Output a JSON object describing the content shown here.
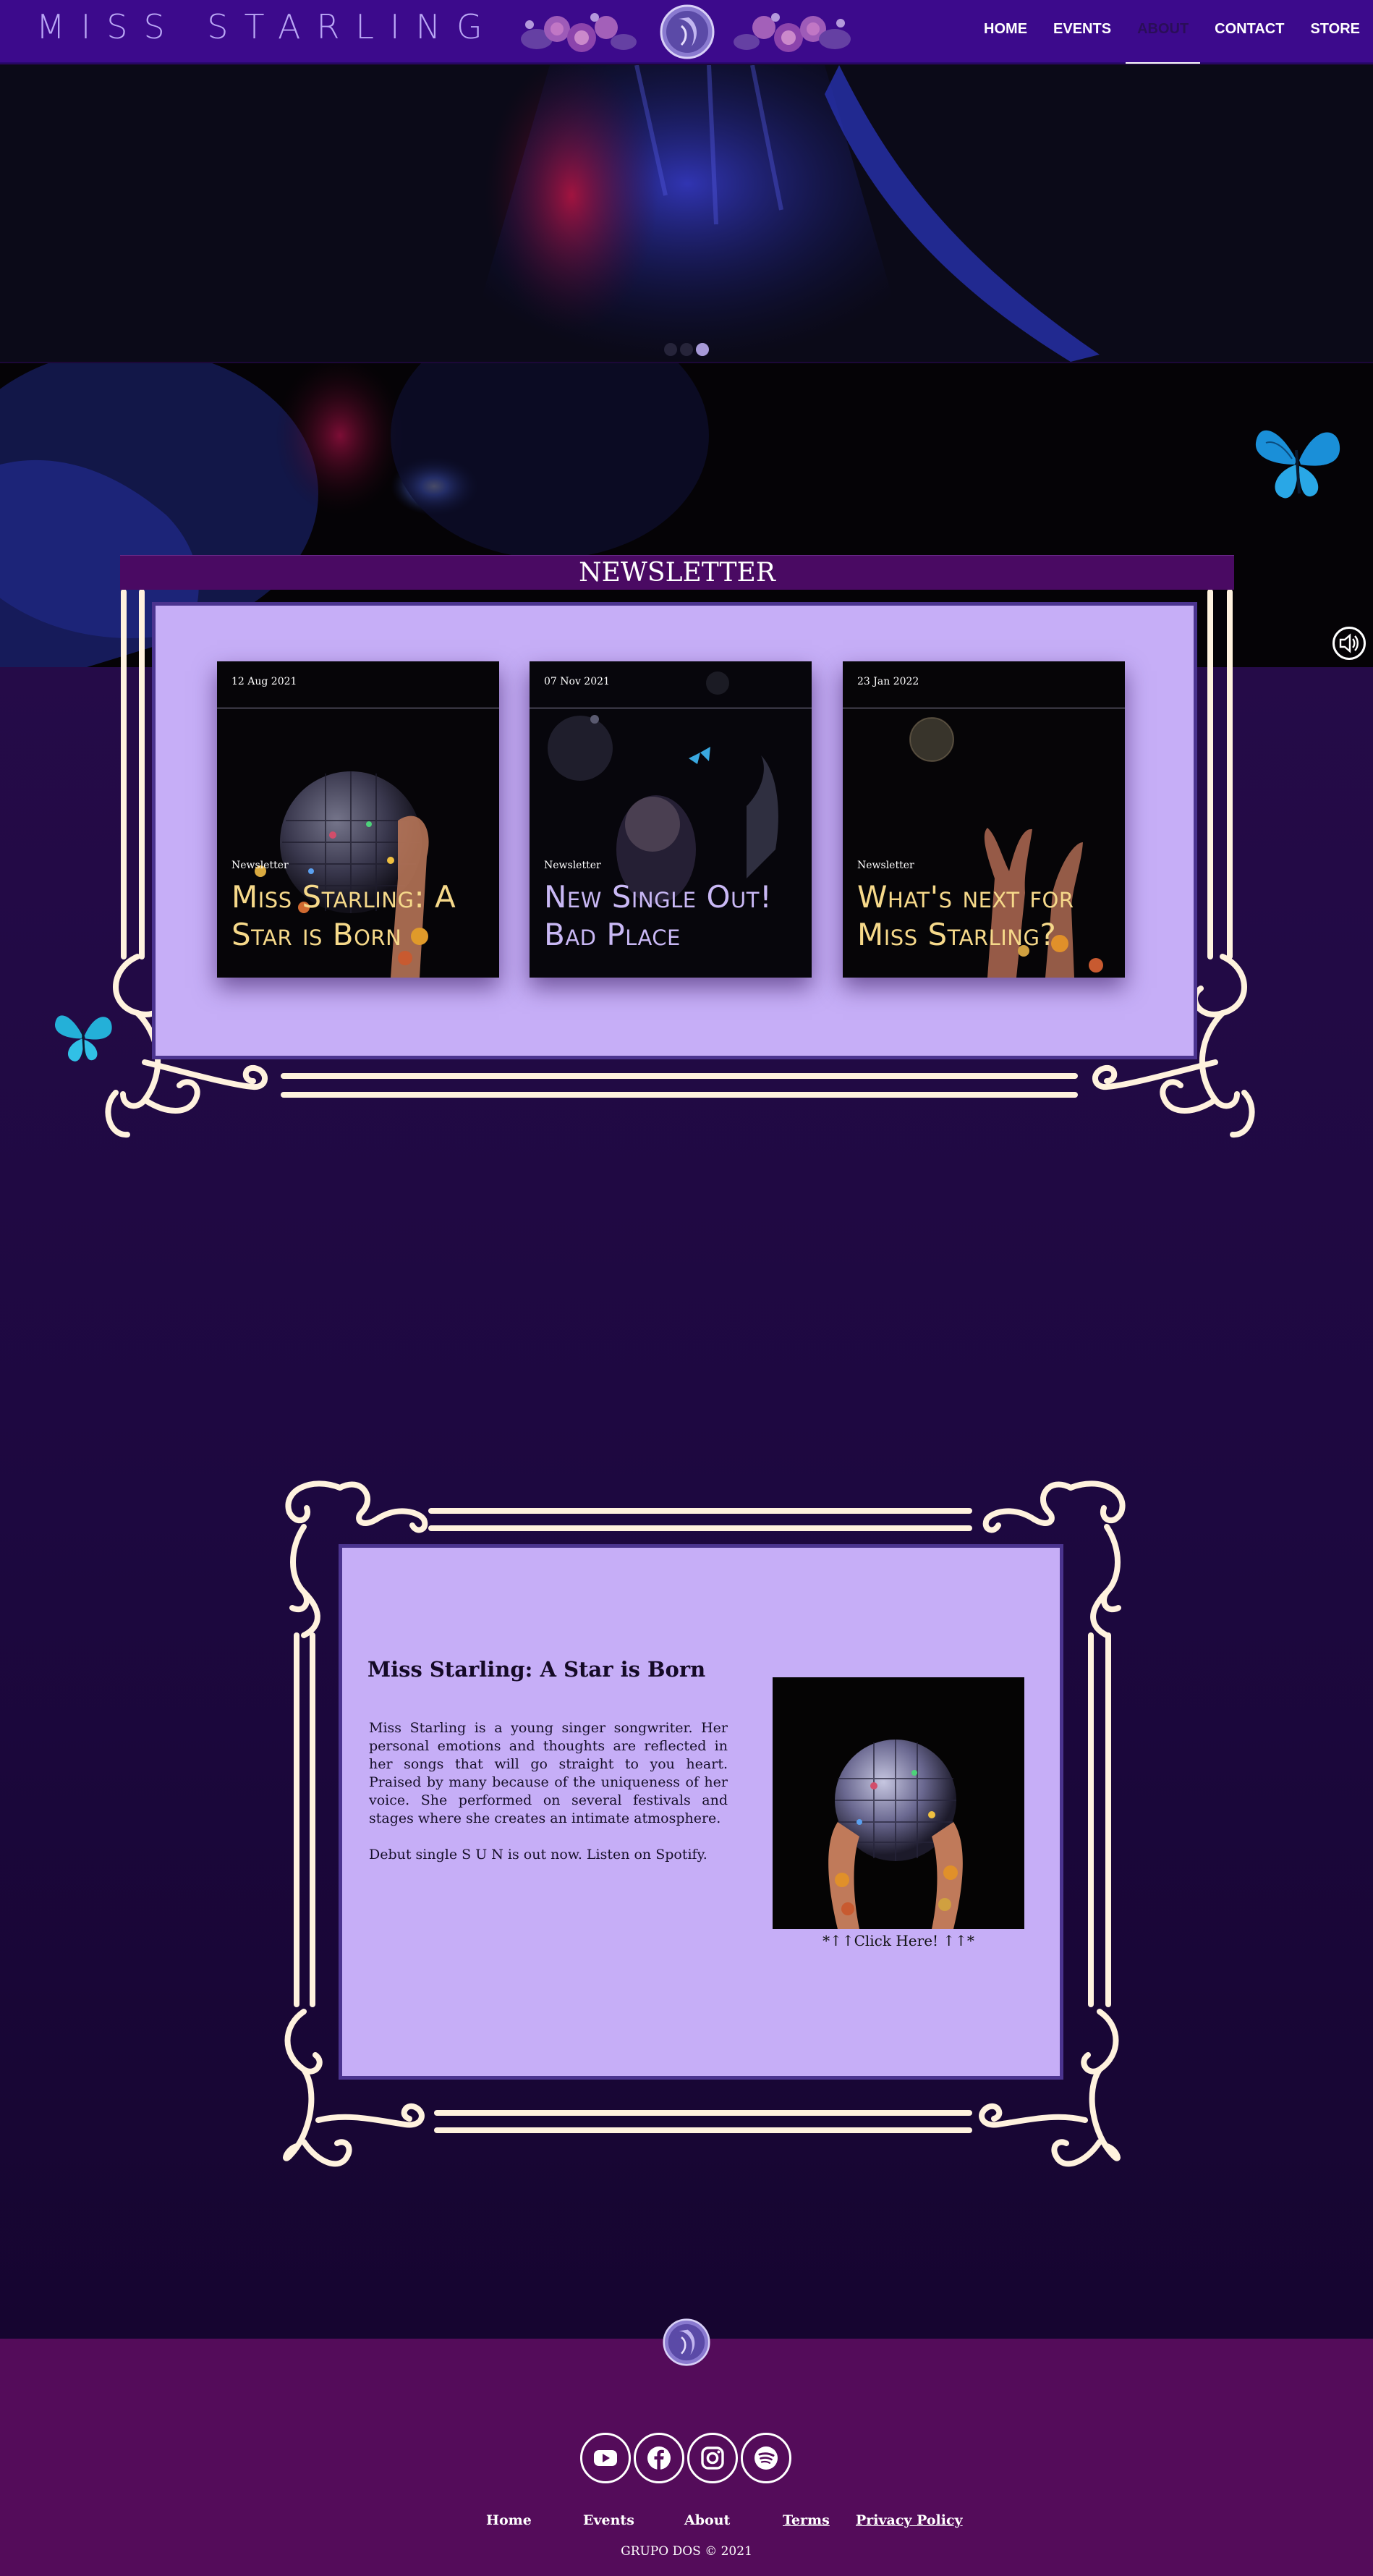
{
  "header": {
    "logo": "MISS STARLING",
    "nav": [
      {
        "label": "HOME"
      },
      {
        "label": "EVENTS"
      },
      {
        "label": "ABOUT",
        "active": true
      },
      {
        "label": "CONTACT"
      },
      {
        "label": "STORE"
      }
    ]
  },
  "hero": {
    "slides_count": 3,
    "active_slide": 3
  },
  "newsletter": {
    "title": "NEWSLETTER",
    "cards": [
      {
        "date": "12 Aug 2021",
        "category": "Newsletter",
        "title": "Miss Starling: A Star is Born",
        "title_color": "#f6d98a"
      },
      {
        "date": "07 Nov 2021",
        "category": "Newsletter",
        "title": "New Single Out! Bad Place",
        "title_color": "#c9b8f5"
      },
      {
        "date": "23 Jan 2022",
        "category": "Newsletter",
        "title": "What's next for Miss Starling?",
        "title_color": "#f6d98a"
      }
    ]
  },
  "about": {
    "title": "Miss Starling: A Star is Born",
    "paragraph1": "Miss Starling is a young singer songwriter. Her personal emotions and thoughts are reflected in her songs that will go straight to you heart. Praised by many because of the uniqueness of her voice. She performed on several festivals and stages where she creates an intimate atmosphere.",
    "paragraph2": "Debut single S U N is out now. Listen on Spotify.",
    "click_label": "*↑↑Click Here! ↑↑*"
  },
  "footer": {
    "social": [
      "youtube-icon",
      "facebook-icon",
      "instagram-icon",
      "spotify-icon"
    ],
    "links": [
      {
        "label": "Home",
        "underline": false
      },
      {
        "label": "Events",
        "underline": false
      },
      {
        "label": "About",
        "underline": false
      },
      {
        "label": "Terms",
        "underline": true
      },
      {
        "label": "Privacy Policy",
        "underline": true
      }
    ],
    "copyright": "GRUPO DOS © 2021"
  },
  "colors": {
    "header_bg": "#3c0a8c",
    "page_bg": "#1c0838",
    "panel_bg": "#c6aef7",
    "panel_border": "#4b348f",
    "footer_bg": "#540c5a",
    "frame_cream": "#fff2de",
    "card_title_gold": "#f6d98a"
  }
}
